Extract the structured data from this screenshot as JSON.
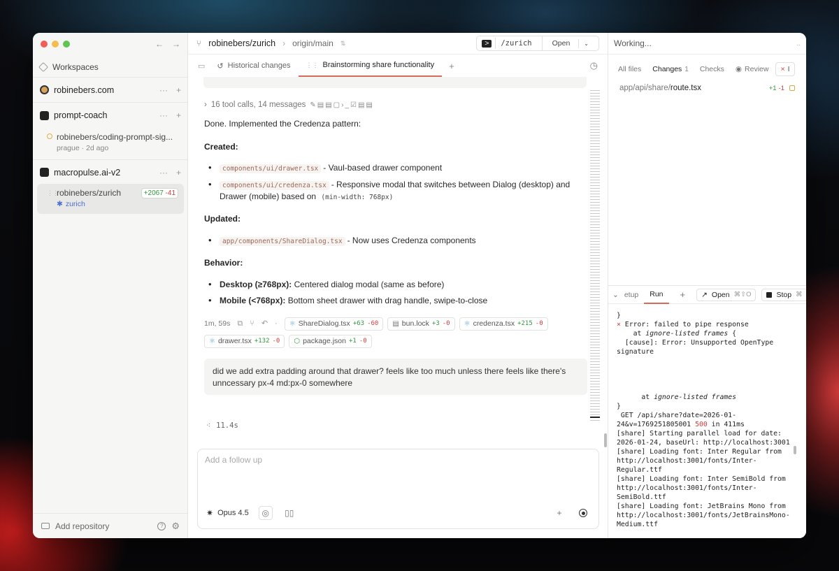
{
  "sidebar": {
    "workspaces_label": "Workspaces",
    "projects": [
      {
        "name": "robinebers.com"
      },
      {
        "name": "prompt-coach"
      },
      {
        "name": "macropulse.ai-v2"
      }
    ],
    "sessions": [
      {
        "title": "robinebers/coding-prompt-sig...",
        "meta_location": "prague",
        "meta_time": "2d ago"
      },
      {
        "title": "robinebers/zurich",
        "branch": "zurich",
        "additions": "+2067",
        "deletions": "-41"
      }
    ],
    "footer": {
      "add_repository": "Add repository"
    }
  },
  "topbar": {
    "repo": "robinebers/zurich",
    "branch": "origin/main",
    "path": "/zurich",
    "open_label": "Open"
  },
  "tabs": [
    {
      "label": "Historical changes"
    },
    {
      "label": "Brainstorming share functionality"
    }
  ],
  "chat": {
    "tool_calls": "16 tool calls, 14 messages",
    "done_text": "Done. Implemented the Credenza pattern:",
    "created_heading": "Created:",
    "created": [
      {
        "code": "components/ui/drawer.tsx",
        "text": "- Vaul-based drawer component"
      },
      {
        "code": "components/ui/credenza.tsx",
        "text": "- Responsive modal that switches between Dialog (desktop) and Drawer (mobile) based on",
        "code2": "(min-width: 768px)"
      }
    ],
    "updated_heading": "Updated:",
    "updated": [
      {
        "code": "app/components/ShareDialog.tsx",
        "text": "- Now uses Credenza components"
      }
    ],
    "behavior_heading": "Behavior:",
    "behavior": [
      {
        "bold": "Desktop (≥768px):",
        "text": "Centered dialog modal (same as before)"
      },
      {
        "bold": "Mobile (<768px):",
        "text": "Bottom sheet drawer with drag handle, swipe-to-close"
      }
    ],
    "duration": "1m, 59s",
    "files": [
      {
        "name": "ShareDialog.tsx",
        "add": "+63",
        "del": "-60",
        "icon": "react-icon"
      },
      {
        "name": "bun.lock",
        "add": "+3",
        "del": "-0",
        "icon": "file-icon"
      },
      {
        "name": "credenza.tsx",
        "add": "+215",
        "del": "-0",
        "icon": "react-icon"
      },
      {
        "name": "drawer.tsx",
        "add": "+132",
        "del": "-0",
        "icon": "react-icon"
      },
      {
        "name": "package.json",
        "add": "+1",
        "del": "-0",
        "icon": "package-icon"
      }
    ],
    "user_message": "did we add extra padding around that drawer? feels like too much unless there feels like there's unncessary px-4 md:px-0 somewhere",
    "thinking_time": "11.4s"
  },
  "composer": {
    "placeholder": "Add a follow up",
    "model": "Opus 4.5"
  },
  "right": {
    "status": "Working...",
    "tabs": [
      {
        "label": "All files"
      },
      {
        "label": "Changes",
        "count": "1"
      },
      {
        "label": "Checks"
      },
      {
        "label": "Review"
      }
    ],
    "changed_file": {
      "dir": "app/api/share/",
      "name": "route.tsx",
      "add": "+1",
      "del": "-1"
    },
    "terminal_tabs": {
      "setup": "etup",
      "run": "Run",
      "open": "Open",
      "open_kbd": "⌘⇧O",
      "stop": "Stop",
      "stop_kbd": "⌘"
    }
  },
  "terminal_lines": {
    "l1": "}",
    "l2_mark": "×",
    "l2": " Error: failed to pipe response",
    "l3_pre": "    at ",
    "l3_it": "ignore-listed frames",
    "l3_post": " {",
    "l4": "  [cause]: Error: Unsupported OpenType signature",
    "l5_pre": "      at ",
    "l5_it": "ignore-listed frames",
    "l6": "}",
    "l7_pre": " GET /api/share?date=2026-01-24&v=1769251805001 ",
    "l7_status": "500",
    "l7_post": " in 411ms",
    "l8": "[share] Starting parallel load for date: 2026-01-24, baseUrl: http://localhost:3001",
    "l9": "[share] Loading font: Inter Regular from http://localhost:3001/fonts/Inter-Regular.ttf",
    "l10": "[share] Loading font: Inter SemiBold from http://localhost:3001/fonts/Inter-SemiBold.ttf",
    "l11": "[share] Loading font: JetBrains Mono from http://localhost:3001/fonts/JetBrainsMono-Medium.ttf"
  },
  "colors": {
    "accent_tab": "#d86a5a",
    "addition": "#2f9a3b",
    "deletion": "#d33a3a",
    "branch": "#4b6fd6"
  }
}
